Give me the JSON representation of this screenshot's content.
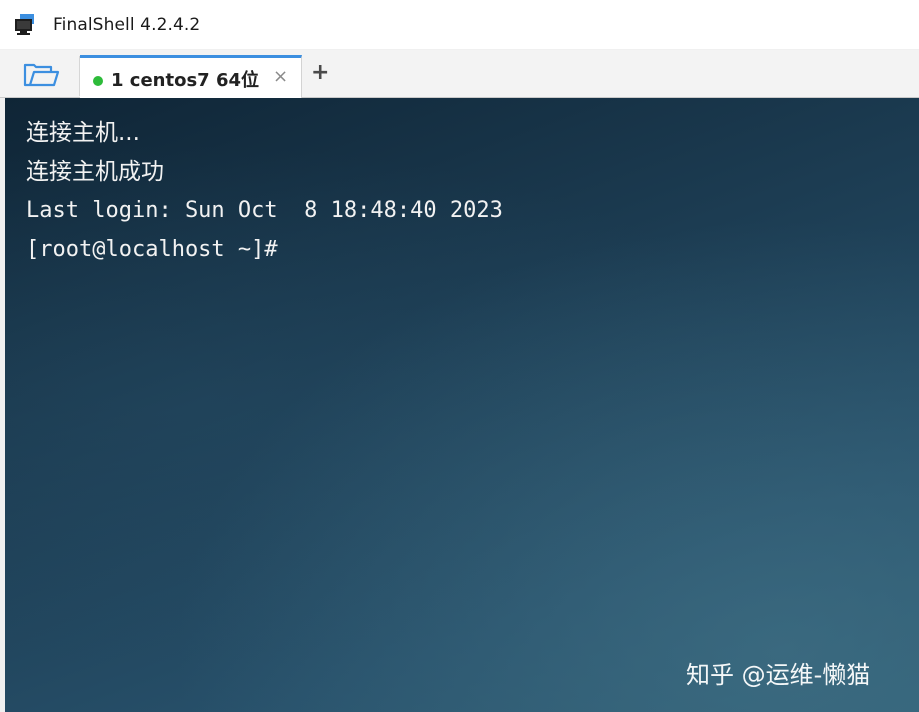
{
  "window": {
    "title": "FinalShell 4.2.4.2"
  },
  "toolbar": {
    "folder_icon": "folder-open-icon"
  },
  "tabs": [
    {
      "label": "1 centos7 64位",
      "status_color": "#2dbb3a",
      "close_glyph": "×",
      "active": true
    }
  ],
  "add_tab_glyph": "+",
  "terminal": {
    "lines": [
      "连接主机...",
      "连接主机成功",
      "Last login: Sun Oct  8 18:48:40 2023",
      "[root@localhost ~]#"
    ]
  },
  "watermark": "知乎 @运维-懒猫",
  "colors": {
    "accent": "#3c8fe0",
    "connected": "#2dbb3a",
    "terminal_text": "#f2f2f2"
  }
}
